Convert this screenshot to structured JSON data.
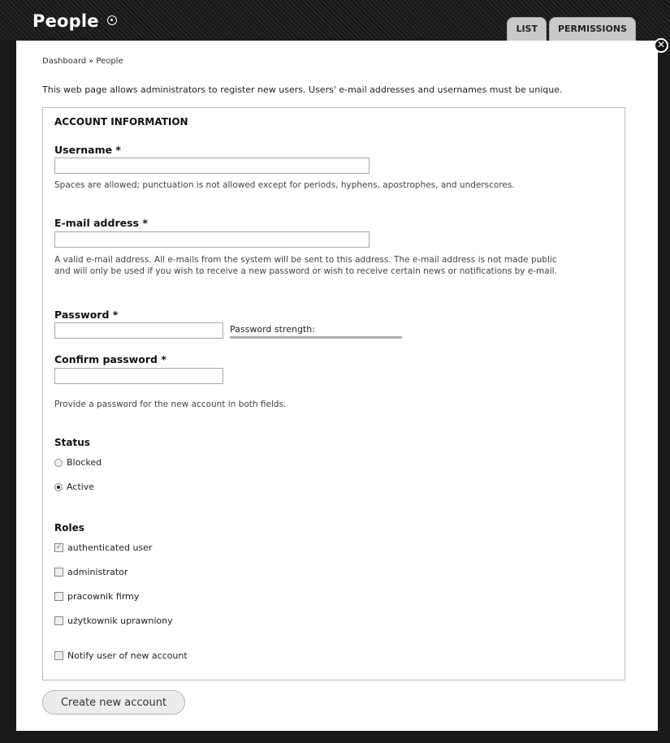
{
  "header": {
    "title": "People",
    "tabs": [
      "LIST",
      "PERMISSIONS"
    ]
  },
  "breadcrumb": {
    "items": [
      "Dashboard",
      "People"
    ],
    "separator": "»"
  },
  "intro": "This web page allows administrators to register new users. Users' e-mail addresses and usernames must be unique.",
  "account": {
    "legend": "ACCOUNT INFORMATION",
    "username": {
      "label": "Username *",
      "value": "",
      "description": "Spaces are allowed; punctuation is not allowed except for periods, hyphens, apostrophes, and underscores."
    },
    "email": {
      "label": "E-mail address *",
      "value": "",
      "description_line1": "A valid e-mail address. All e-mails from the system will be sent to this address. The e-mail address is not made public",
      "description_line2": "and will only be used if you wish to receive a new password or wish to receive certain news or notifications by e-mail."
    },
    "password": {
      "label": "Password *",
      "value": "",
      "strength_label": "Password strength:"
    },
    "confirm_password": {
      "label": "Confirm password *",
      "value": "",
      "description": "Provide a password for the new account in both fields."
    },
    "status": {
      "label": "Status",
      "options": [
        "Blocked",
        "Active"
      ],
      "selected": "Active"
    },
    "roles": {
      "label": "Roles",
      "options": [
        "authenticated user",
        "administrator",
        "pracownik firmy",
        "użytkownik uprawniony"
      ],
      "checked": [
        "authenticated user"
      ]
    },
    "notify": {
      "label": "Notify user of new account",
      "checked": false
    }
  },
  "submit_label": "Create new account",
  "colors": {
    "overlay": "#1a1a1a",
    "tab_bg": "#c9c9c9",
    "modal_bg": "#ffffff"
  }
}
